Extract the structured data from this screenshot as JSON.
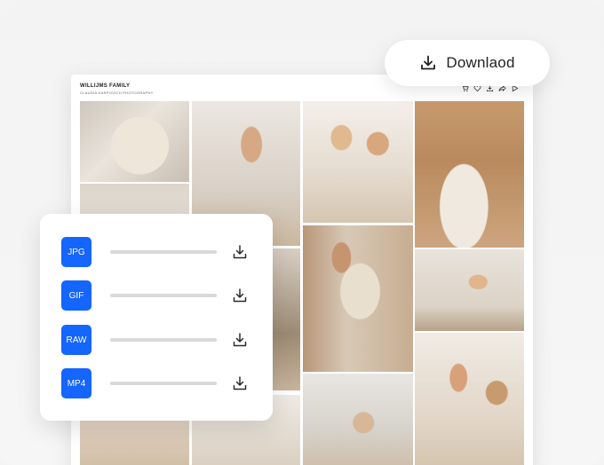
{
  "gallery": {
    "title": "WILLIJMS FAMILY",
    "subtitle": "CLAUDIA KARPOVICH PHOTOGRAPHY",
    "actions": [
      "cart-icon",
      "heart-icon",
      "download-icon",
      "share-icon",
      "play-icon"
    ]
  },
  "download_button": {
    "label": "Downlaod",
    "icon": "download-icon"
  },
  "formats": [
    {
      "label": "JPG",
      "progress": 0.0,
      "icon": "download-icon"
    },
    {
      "label": "GIF",
      "progress": 0.0,
      "icon": "download-icon"
    },
    {
      "label": "RAW",
      "progress": 0.0,
      "icon": "download-icon"
    },
    {
      "label": "MP4",
      "progress": 0.0,
      "icon": "download-icon"
    }
  ],
  "colors": {
    "accent": "#1565ff",
    "background": "#f4f4f4",
    "panel": "#ffffff",
    "bar": "#d9d9dc"
  }
}
